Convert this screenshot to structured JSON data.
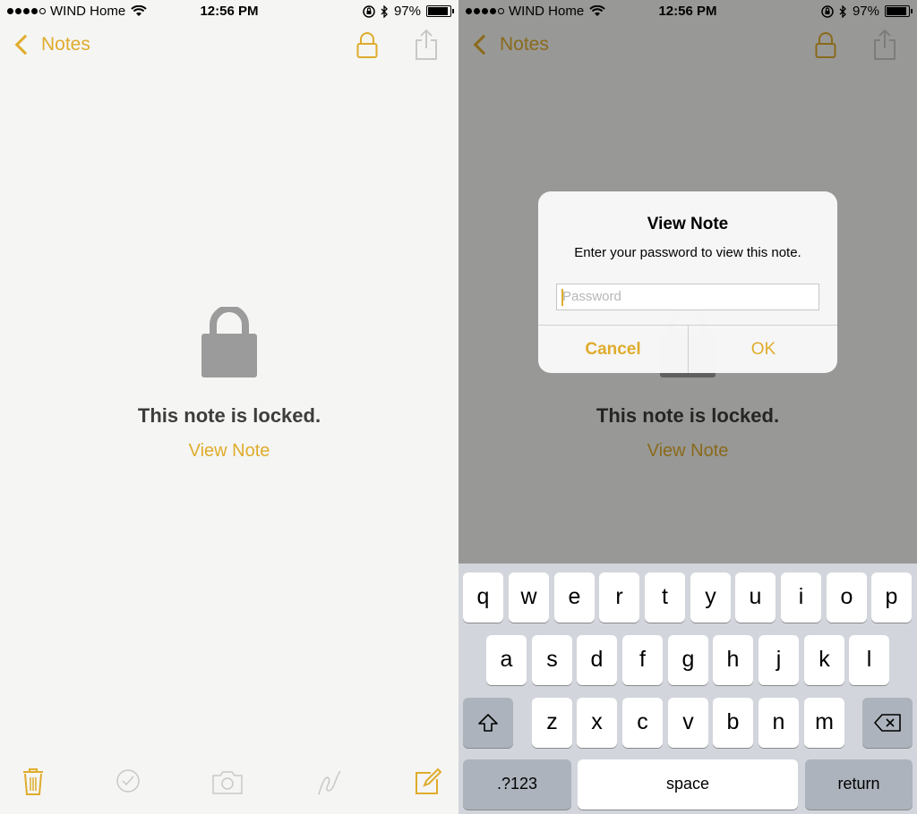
{
  "status": {
    "carrier": "WIND Home",
    "time": "12:56 PM",
    "battery": "97%"
  },
  "nav": {
    "back_label": "Notes"
  },
  "note": {
    "locked_text": "This note is locked.",
    "view_link": "View Note"
  },
  "alert": {
    "title": "View Note",
    "message": "Enter your password to view this note.",
    "placeholder": "Password",
    "cancel": "Cancel",
    "ok": "OK"
  },
  "keyboard": {
    "row1": [
      "q",
      "w",
      "e",
      "r",
      "t",
      "y",
      "u",
      "i",
      "o",
      "p"
    ],
    "row2": [
      "a",
      "s",
      "d",
      "f",
      "g",
      "h",
      "j",
      "k",
      "l"
    ],
    "row3": [
      "z",
      "x",
      "c",
      "v",
      "b",
      "n",
      "m"
    ],
    "numbers": ".?123",
    "space": "space",
    "return": "return"
  },
  "colors": {
    "accent": "#dfac2c",
    "keyboard_bg": "#d2d5db",
    "modifier_key": "#acb3bc"
  }
}
